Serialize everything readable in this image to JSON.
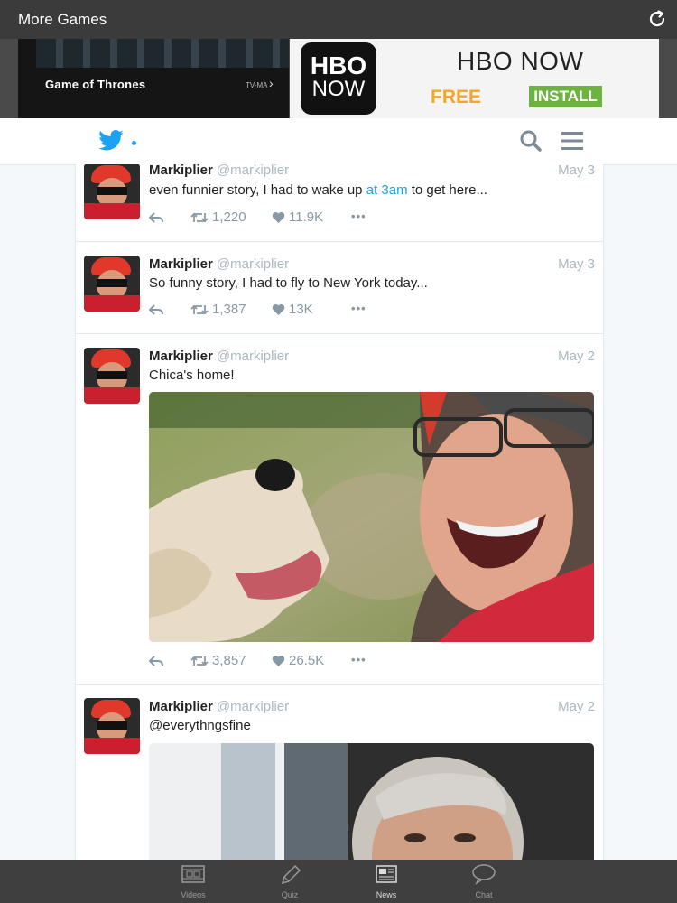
{
  "topbar": {
    "title": "More Games",
    "refresh_icon": "refresh-icon"
  },
  "ad": {
    "show_title": "Game of Thrones",
    "rating": "TV-MA",
    "logo_line1": "HBO",
    "logo_line2": "NOW",
    "headline": "HBO NOW",
    "free_label": "FREE",
    "install_label": "INSTALL",
    "adchoices": "✕ ▷"
  },
  "twitter_header": {
    "logo_icon": "twitter-bird-icon",
    "search_icon": "search-icon",
    "menu_icon": "menu-icon"
  },
  "tweets": [
    {
      "name": "Markiplier",
      "handle": "@markiplier",
      "date": "May 3",
      "text_before": "even funnier story, I had to wake up ",
      "text_link": "at 3am",
      "text_after": " to get here...",
      "retweets": "1,220",
      "likes": "11.9K"
    },
    {
      "name": "Markiplier",
      "handle": "@markiplier",
      "date": "May 3",
      "text": "So funny story, I had to fly to New York today...",
      "retweets": "1,387",
      "likes": "13K"
    },
    {
      "name": "Markiplier",
      "handle": "@markiplier",
      "date": "May 2",
      "text": "Chica's home!",
      "retweets": "3,857",
      "likes": "26.5K"
    },
    {
      "name": "Markiplier",
      "handle": "@markiplier",
      "date": "May 2",
      "text": "@everythngsfine"
    }
  ],
  "more_glyph": "•••",
  "tabbar": [
    {
      "label": "Videos",
      "icon": "film-icon"
    },
    {
      "label": "Quiz",
      "icon": "pencil-icon"
    },
    {
      "label": "News",
      "icon": "newspaper-icon",
      "active": true
    },
    {
      "label": "Chat",
      "icon": "chat-bubble-icon"
    }
  ]
}
